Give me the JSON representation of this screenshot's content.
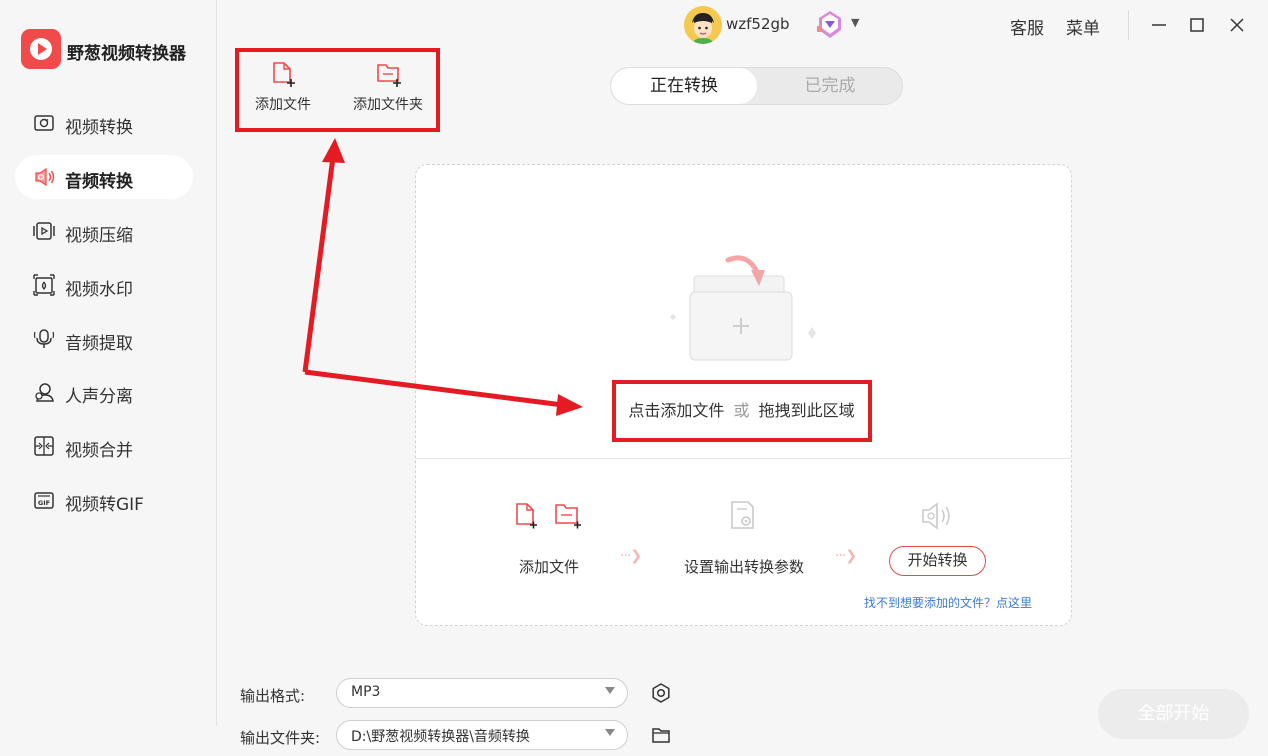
{
  "app": {
    "title": "野葱视频转换器"
  },
  "sidebar": {
    "items": [
      {
        "label": "视频转换",
        "icon": "video-convert-icon",
        "active": false
      },
      {
        "label": "音频转换",
        "icon": "audio-convert-icon",
        "active": true
      },
      {
        "label": "视频压缩",
        "icon": "video-compress-icon",
        "active": false
      },
      {
        "label": "视频水印",
        "icon": "video-watermark-icon",
        "active": false
      },
      {
        "label": "音频提取",
        "icon": "audio-extract-icon",
        "active": false
      },
      {
        "label": "人声分离",
        "icon": "vocal-separate-icon",
        "active": false
      },
      {
        "label": "视频合并",
        "icon": "video-merge-icon",
        "active": false
      },
      {
        "label": "视频转GIF",
        "icon": "gif-icon",
        "active": false
      }
    ]
  },
  "header": {
    "username": "wzf52gb",
    "service_label": "客服",
    "menu_label": "菜单"
  },
  "toolbar": {
    "add_file_label": "添加文件",
    "add_folder_label": "添加文件夹"
  },
  "tabs": [
    {
      "label": "正在转换",
      "active": true
    },
    {
      "label": "已完成",
      "active": false
    }
  ],
  "dropzone": {
    "prompt_click": "点击添加文件",
    "prompt_or": "或",
    "prompt_drag": "拖拽到此区域",
    "steps": {
      "add_file": "添加文件",
      "set_params": "设置输出转换参数",
      "start": "开始转换"
    },
    "help_link": "找不到想要添加的文件？点这里"
  },
  "bottom": {
    "format_label": "输出格式:",
    "format_value": "MP3",
    "folder_label": "输出文件夹:",
    "folder_value": "D:\\野葱视频转换器\\音频转换",
    "start_all_label": "全部开始"
  },
  "colors": {
    "accent": "#f04a4a",
    "annotation": "#e51b24",
    "link": "#3a7bd5"
  }
}
